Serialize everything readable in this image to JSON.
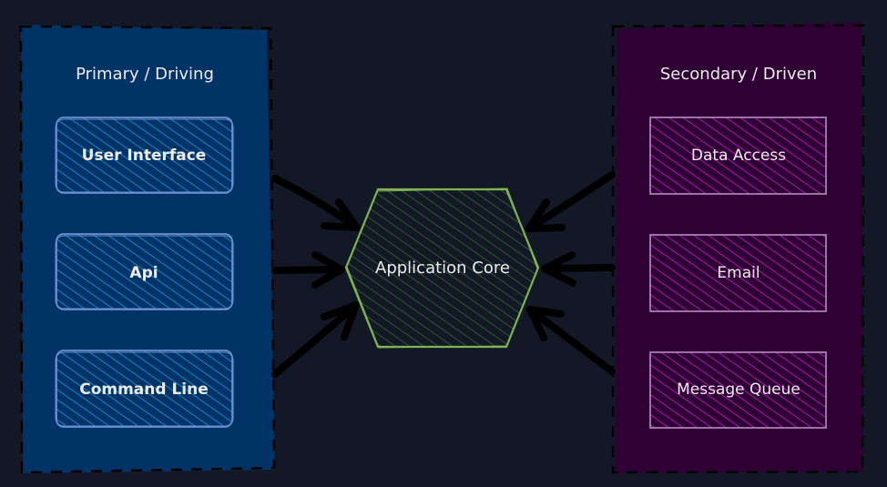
{
  "canvas": {
    "background": "#121826"
  },
  "groups": {
    "primary": {
      "title": "Primary / Driving",
      "fill": "#023366",
      "border": "#000000",
      "nodes": [
        {
          "id": "user-interface",
          "label": "User Interface",
          "stroke": "#6a8fcf",
          "hatch": "#1b9ae6"
        },
        {
          "id": "api",
          "label": "Api",
          "stroke": "#6a8fcf",
          "hatch": "#1b9ae6"
        },
        {
          "id": "command-line",
          "label": "Command Line",
          "stroke": "#6a8fcf",
          "hatch": "#1b9ae6"
        }
      ]
    },
    "secondary": {
      "title": "Secondary / Driven",
      "fill": "#2f0033",
      "border": "#000000",
      "nodes": [
        {
          "id": "data-access",
          "label": "Data Access",
          "stroke": "#a77fb3",
          "hatch": "#c81ed3"
        },
        {
          "id": "email",
          "label": "Email",
          "stroke": "#a77fb3",
          "hatch": "#c81ed3"
        },
        {
          "id": "message-queue",
          "label": "Message Queue",
          "stroke": "#a77fb3",
          "hatch": "#c81ed3"
        }
      ]
    }
  },
  "core": {
    "label": "Application Core",
    "stroke": "#7fb354",
    "hatch": "#3f7a2e"
  },
  "arrows": {
    "color": "#000000",
    "edges": [
      {
        "from": "primary",
        "to": "core",
        "direction": "inward"
      },
      {
        "from": "primary",
        "to": "core",
        "direction": "inward"
      },
      {
        "from": "primary",
        "to": "core",
        "direction": "inward"
      },
      {
        "from": "secondary",
        "to": "core",
        "direction": "inward"
      },
      {
        "from": "secondary",
        "to": "core",
        "direction": "inward"
      },
      {
        "from": "secondary",
        "to": "core",
        "direction": "inward"
      }
    ]
  }
}
